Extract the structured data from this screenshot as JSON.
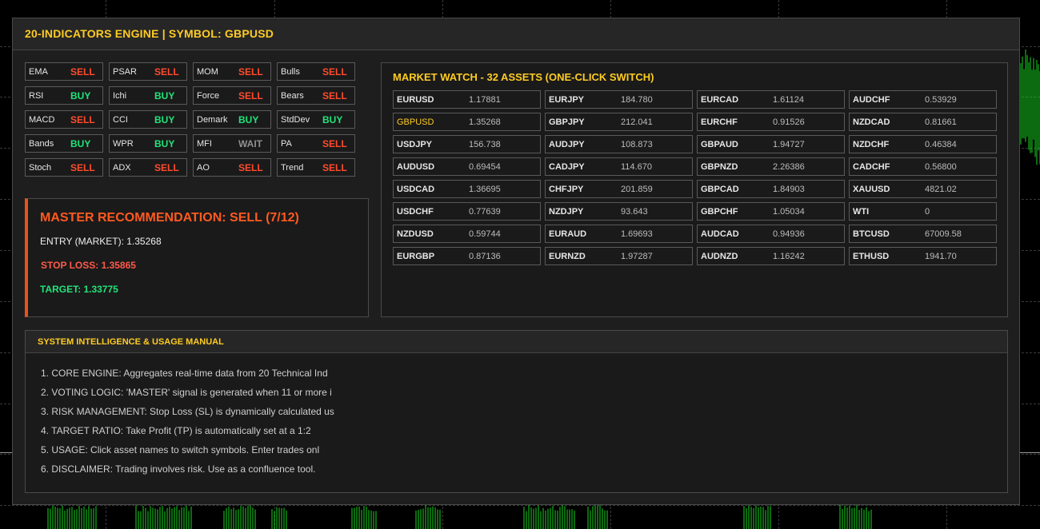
{
  "header": {
    "title": "20-INDICATORS ENGINE | SYMBOL: GBPUSD"
  },
  "colors": {
    "accent": "#ffcc22",
    "sell": "#ff4b2b",
    "buy": "#22e37a",
    "wait": "#8f8f8f",
    "panel": "#1e1e1e"
  },
  "indicators": [
    {
      "name": "EMA",
      "signal": "SELL"
    },
    {
      "name": "PSAR",
      "signal": "SELL"
    },
    {
      "name": "MOM",
      "signal": "SELL"
    },
    {
      "name": "Bulls",
      "signal": "SELL"
    },
    {
      "name": "RSI",
      "signal": "BUY"
    },
    {
      "name": "Ichi",
      "signal": "BUY"
    },
    {
      "name": "Force",
      "signal": "SELL"
    },
    {
      "name": "Bears",
      "signal": "SELL"
    },
    {
      "name": "MACD",
      "signal": "SELL"
    },
    {
      "name": "CCI",
      "signal": "BUY"
    },
    {
      "name": "Demark",
      "signal": "BUY"
    },
    {
      "name": "StdDev",
      "signal": "BUY"
    },
    {
      "name": "Bands",
      "signal": "BUY"
    },
    {
      "name": "WPR",
      "signal": "BUY"
    },
    {
      "name": "MFI",
      "signal": "WAIT"
    },
    {
      "name": "PA",
      "signal": "SELL"
    },
    {
      "name": "Stoch",
      "signal": "SELL"
    },
    {
      "name": "ADX",
      "signal": "SELL"
    },
    {
      "name": "AO",
      "signal": "SELL"
    },
    {
      "name": "Trend",
      "signal": "SELL"
    }
  ],
  "master": {
    "title": "MASTER RECOMMENDATION: SELL (7/12)",
    "entry": "ENTRY (MARKET): 1.35268",
    "stop_loss": "STOP LOSS: 1.35865",
    "target": "TARGET: 1.33775"
  },
  "market_watch": {
    "title": "MARKET WATCH - 32 ASSETS (ONE-CLICK SWITCH)",
    "active_symbol": "GBPUSD",
    "columns": [
      [
        {
          "symbol": "EURUSD",
          "price": "1.17881"
        },
        {
          "symbol": "GBPUSD",
          "price": "1.35268"
        },
        {
          "symbol": "USDJPY",
          "price": "156.738"
        },
        {
          "symbol": "AUDUSD",
          "price": "0.69454"
        },
        {
          "symbol": "USDCAD",
          "price": "1.36695"
        },
        {
          "symbol": "USDCHF",
          "price": "0.77639"
        },
        {
          "symbol": "NZDUSD",
          "price": "0.59744"
        },
        {
          "symbol": "EURGBP",
          "price": "0.87136"
        }
      ],
      [
        {
          "symbol": "EURJPY",
          "price": "184.780"
        },
        {
          "symbol": "GBPJPY",
          "price": "212.041"
        },
        {
          "symbol": "AUDJPY",
          "price": "108.873"
        },
        {
          "symbol": "CADJPY",
          "price": "114.670"
        },
        {
          "symbol": "CHFJPY",
          "price": "201.859"
        },
        {
          "symbol": "NZDJPY",
          "price": "93.643"
        },
        {
          "symbol": "EURAUD",
          "price": "1.69693"
        },
        {
          "symbol": "EURNZD",
          "price": "1.97287"
        }
      ],
      [
        {
          "symbol": "EURCAD",
          "price": "1.61124"
        },
        {
          "symbol": "EURCHF",
          "price": "0.91526"
        },
        {
          "symbol": "GBPAUD",
          "price": "1.94727"
        },
        {
          "symbol": "GBPNZD",
          "price": "2.26386"
        },
        {
          "symbol": "GBPCAD",
          "price": "1.84903"
        },
        {
          "symbol": "GBPCHF",
          "price": "1.05034"
        },
        {
          "symbol": "AUDCAD",
          "price": "0.94936"
        },
        {
          "symbol": "AUDNZD",
          "price": "1.16242"
        }
      ],
      [
        {
          "symbol": "AUDCHF",
          "price": "0.53929"
        },
        {
          "symbol": "NZDCAD",
          "price": "0.81661"
        },
        {
          "symbol": "NZDCHF",
          "price": "0.46384"
        },
        {
          "symbol": "CADCHF",
          "price": "0.56800"
        },
        {
          "symbol": "XAUUSD",
          "price": "4821.02"
        },
        {
          "symbol": "WTI",
          "price": "0"
        },
        {
          "symbol": "BTCUSD",
          "price": "67009.58"
        },
        {
          "symbol": "ETHUSD",
          "price": "1941.70"
        }
      ]
    ]
  },
  "manual": {
    "title": "SYSTEM INTELLIGENCE & USAGE MANUAL",
    "lines": [
      "1. CORE ENGINE: Aggregates real-time data from 20 Technical Ind",
      "2. VOTING LOGIC: 'MASTER' signal is generated when 11 or more i",
      "3. RISK MANAGEMENT: Stop Loss (SL) is dynamically calculated us",
      "4. TARGET RATIO: Take Profit (TP) is automatically set at a 1:2",
      "5. USAGE: Click asset names to switch symbols. Enter trades onl",
      "6. DISCLAIMER: Trading involves risk. Use as a confluence tool."
    ]
  }
}
